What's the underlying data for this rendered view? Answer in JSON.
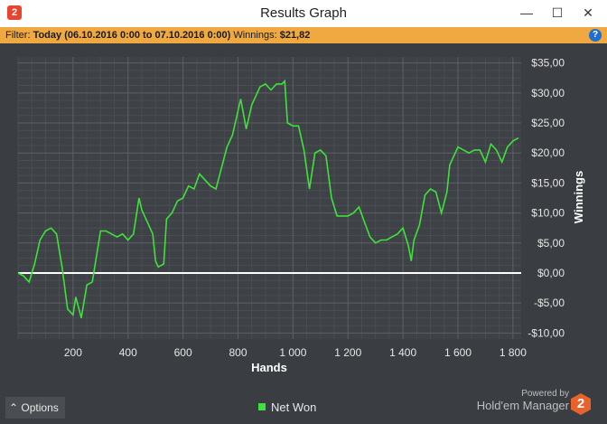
{
  "window": {
    "title": "Results Graph",
    "minimize": "—",
    "maximize": "☐",
    "close": "✕",
    "app_icon": "2"
  },
  "filter": {
    "label": "Filter:",
    "value": "Today (06.10.2016 0:00 to 07.10.2016 0:00)",
    "winnings_label": "Winnings:",
    "winnings_value": "$21,82"
  },
  "help_icon": "?",
  "options_label": "Options",
  "options_icon": "⌃",
  "legend_label": "Net Won",
  "brand": {
    "powered_by": "Powered by",
    "name": "Hold'em Manager",
    "logo": "2"
  },
  "colors": {
    "accent": "#f0a941",
    "line": "#3ee23b",
    "background": "#3a3d42",
    "zero_line": "#ffffff"
  },
  "chart_data": {
    "type": "line",
    "xlabel": "Hands",
    "ylabel": "Winnings",
    "xlim": [
      0,
      1830
    ],
    "ylim": [
      -11,
      36
    ],
    "x_ticks": [
      200,
      400,
      600,
      800,
      1000,
      1200,
      1400,
      1600,
      1800
    ],
    "x_tick_labels": [
      "200",
      "400",
      "600",
      "800",
      "1 000",
      "1 200",
      "1 400",
      "1 600",
      "1 800"
    ],
    "y_ticks": [
      35,
      30,
      25,
      20,
      15,
      10,
      5,
      0,
      -5,
      -10
    ],
    "y_tick_labels": [
      "$35,00",
      "$30,00",
      "$25,00",
      "$20,00",
      "$15,00",
      "$10,00",
      "$5,00",
      "$0,00",
      "-$5,00",
      "-$10,00"
    ],
    "grid": true,
    "series": [
      {
        "name": "Net Won",
        "x": [
          0,
          20,
          40,
          60,
          80,
          100,
          120,
          140,
          160,
          180,
          200,
          210,
          230,
          250,
          270,
          300,
          320,
          340,
          360,
          380,
          400,
          420,
          440,
          450,
          470,
          490,
          500,
          510,
          530,
          540,
          560,
          580,
          600,
          620,
          640,
          660,
          700,
          720,
          760,
          780,
          800,
          810,
          830,
          850,
          870,
          880,
          900,
          920,
          940,
          960,
          970,
          980,
          1000,
          1020,
          1040,
          1060,
          1080,
          1100,
          1120,
          1140,
          1160,
          1170,
          1200,
          1220,
          1240,
          1260,
          1280,
          1300,
          1320,
          1340,
          1360,
          1380,
          1400,
          1420,
          1430,
          1440,
          1460,
          1480,
          1500,
          1520,
          1540,
          1560,
          1570,
          1590,
          1600,
          1620,
          1640,
          1660,
          1680,
          1700,
          1720,
          1740,
          1760,
          1780,
          1800,
          1820
        ],
        "y": [
          0,
          -0.5,
          -1.5,
          1.5,
          5.5,
          7,
          7.5,
          6.5,
          1,
          -6,
          -7,
          -4,
          -7.5,
          -2,
          -1.5,
          7,
          7,
          6.5,
          6,
          6.5,
          5.5,
          6.5,
          12.5,
          10.5,
          8.5,
          6.5,
          2,
          1,
          1.5,
          9,
          10,
          12,
          12.5,
          14.5,
          14,
          16.5,
          14.5,
          14,
          21,
          23,
          27,
          29,
          24,
          28,
          30,
          31,
          31.5,
          30.5,
          31.5,
          31.5,
          32,
          25,
          24.5,
          24.5,
          20.5,
          14,
          20,
          20.5,
          19.5,
          12.5,
          9.5,
          9.5,
          9.5,
          10,
          11,
          8.5,
          6,
          5,
          5.5,
          5.5,
          6,
          6.5,
          7.5,
          4.5,
          2,
          5.5,
          8,
          13,
          14,
          13.5,
          10,
          13.5,
          18,
          20,
          21,
          20.5,
          20,
          20.5,
          20.5,
          18.5,
          21.5,
          20.5,
          18.5,
          21,
          22,
          22.5
        ]
      }
    ]
  }
}
